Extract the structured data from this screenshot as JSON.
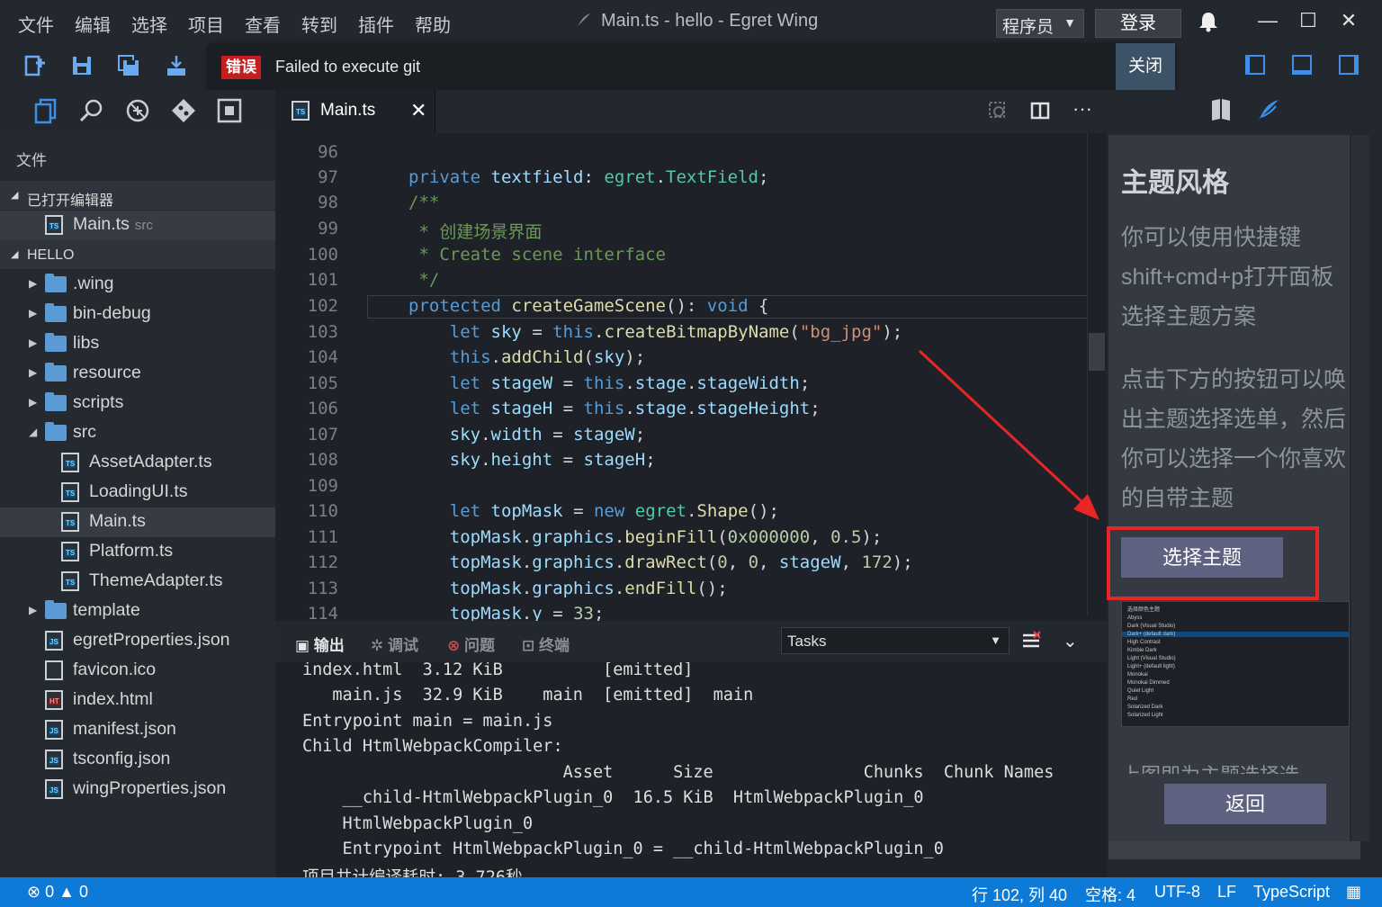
{
  "app": {
    "window_title": "Main.ts - hello - Egret Wing"
  },
  "menu": {
    "items": [
      "文件",
      "编辑",
      "选择",
      "项目",
      "查看",
      "转到",
      "插件",
      "帮助"
    ]
  },
  "header": {
    "role": "程序员",
    "login": "登录"
  },
  "notification": {
    "badge": "错误",
    "message": "Failed to execute git",
    "close": "关闭"
  },
  "sidebar": {
    "title": "文件",
    "open_editors": "已打开编辑器",
    "open_file": {
      "name": "Main.ts",
      "dir": "src"
    },
    "project": "HELLO",
    "tree": [
      {
        "name": ".wing",
        "type": "folder"
      },
      {
        "name": "bin-debug",
        "type": "folder"
      },
      {
        "name": "libs",
        "type": "folder"
      },
      {
        "name": "resource",
        "type": "folder"
      },
      {
        "name": "scripts",
        "type": "folder"
      },
      {
        "name": "src",
        "type": "folder-open"
      },
      {
        "name": "AssetAdapter.ts",
        "type": "ts"
      },
      {
        "name": "LoadingUI.ts",
        "type": "ts"
      },
      {
        "name": "Main.ts",
        "type": "ts"
      },
      {
        "name": "Platform.ts",
        "type": "ts"
      },
      {
        "name": "ThemeAdapter.ts",
        "type": "ts"
      },
      {
        "name": "template",
        "type": "folder"
      },
      {
        "name": "egretProperties.json",
        "type": "json"
      },
      {
        "name": "favicon.ico",
        "type": "file"
      },
      {
        "name": "index.html",
        "type": "html"
      },
      {
        "name": "manifest.json",
        "type": "json"
      },
      {
        "name": "tsconfig.json",
        "type": "json"
      },
      {
        "name": "wingProperties.json",
        "type": "json"
      }
    ]
  },
  "editor": {
    "tab": "Main.ts",
    "line_numbers": [
      "96",
      "97",
      "98",
      "99",
      "100",
      "101",
      "102",
      "103",
      "104",
      "105",
      "106",
      "107",
      "108",
      "109",
      "110",
      "111",
      "112",
      "113",
      "114"
    ]
  },
  "panel": {
    "tabs": [
      "输出",
      "调试",
      "问题",
      "终端"
    ],
    "tasks_select": "Tasks",
    "output_lines": [
      "index.html  3.12 KiB          [emitted]",
      "   main.js  32.9 KiB    main  [emitted]  main",
      "Entrypoint main = main.js",
      "Child HtmlWebpackCompiler:",
      "                          Asset      Size               Chunks  Chunk Names",
      "    __child-HtmlWebpackPlugin_0  16.5 KiB  HtmlWebpackPlugin_0",
      "    HtmlWebpackPlugin_0",
      "    Entrypoint HtmlWebpackPlugin_0 = __child-HtmlWebpackPlugin_0",
      "项目共计编译耗时: 3.726秒"
    ]
  },
  "right_panel": {
    "title": "主题风格",
    "paragraph1": [
      "你可以使用快捷键",
      "shift+cmd+p打开面板",
      "选择主题方案"
    ],
    "paragraph2": [
      "点击下方的按钮可以唤",
      "出主题选择选单，然后",
      "你可以选择一个你喜欢",
      "的自带主题"
    ],
    "choose_button": "选择主题",
    "cut_text": "上图即为主题选择选",
    "back_button": "返回",
    "theme_list": [
      "选择颜色主题",
      "Abyss",
      "Dark (Visual Studio)",
      "Dark+ (default dark)",
      "High Contrast",
      "Kimbie Dark",
      "Light (Visual Studio)",
      "Light+ (default light)",
      "Monokai",
      "Monokai Dimmed",
      "Quiet Light",
      "Red",
      "Solarized Dark",
      "Solarized Light"
    ]
  },
  "statusbar": {
    "errors": "0",
    "warnings": "0",
    "position": "行 102, 列 40",
    "spaces": "空格: 4",
    "encoding": "UTF-8",
    "eol": "LF",
    "language": "TypeScript"
  }
}
